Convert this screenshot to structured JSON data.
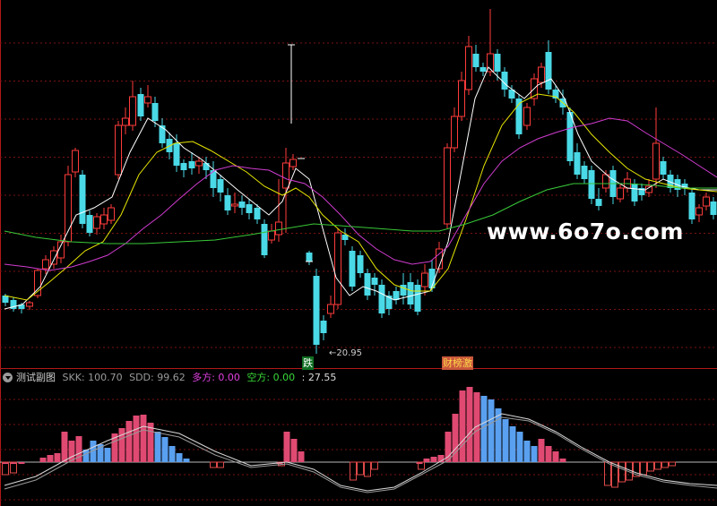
{
  "watermark": "www.6o7o.com",
  "main_panel": {
    "low_marker": "←20.95",
    "signal_down": "跌",
    "signal_up": "财榜激",
    "colors": {
      "up": "#ff3b3b",
      "down": "#4ad9e6",
      "ma_white": "#ffffff",
      "ma_yellow": "#e6e600",
      "ma_magenta": "#d03cd0",
      "ma_green": "#38c838"
    }
  },
  "indicator": {
    "name": "测试副图",
    "items": [
      {
        "label": "SKK: 100.70",
        "color": "#9a9a9a"
      },
      {
        "label": "SDD: 99.62",
        "color": "#9a9a9a"
      },
      {
        "label": "多方: 0.00",
        "color": "#e040e0"
      },
      {
        "label": "空方: 0.00",
        "color": "#38d838"
      },
      {
        "label": ": 27.55",
        "color": "#dcdcdc"
      }
    ],
    "colors": {
      "positive": "#e04a72",
      "negative_bar": "#5aa0f0",
      "down_outline": "#e04a4a",
      "line_skk": "#d8d8d8",
      "line_sdd": "#9a9a9a"
    }
  }
}
